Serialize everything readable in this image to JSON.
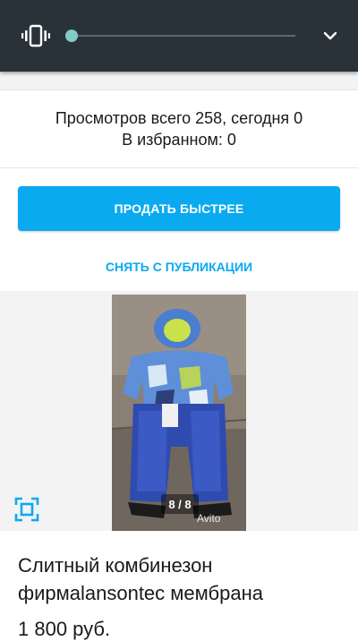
{
  "volume": {
    "mode_icon": "vibrate-icon",
    "expand_icon": "chevron-down-icon",
    "level": 0,
    "accent_color": "#80cbc4"
  },
  "stats": {
    "views_text": "Просмотров всего 258, сегодня 0",
    "favorites_text": "В избранном: 0"
  },
  "actions": {
    "sell_faster_label": "ПРОДАТЬ БЫСТРЕЕ",
    "unpublish_label": "СНЯТЬ С ПУБЛИКАЦИИ",
    "accent_color": "#0aaaf0"
  },
  "gallery": {
    "counter": "8 / 8",
    "watermark": "Avito",
    "fullscreen_icon": "fullscreen-icon"
  },
  "listing": {
    "title": "Слитный комбинезон фирмаlansontec мембрана",
    "price": "1 800 руб."
  }
}
